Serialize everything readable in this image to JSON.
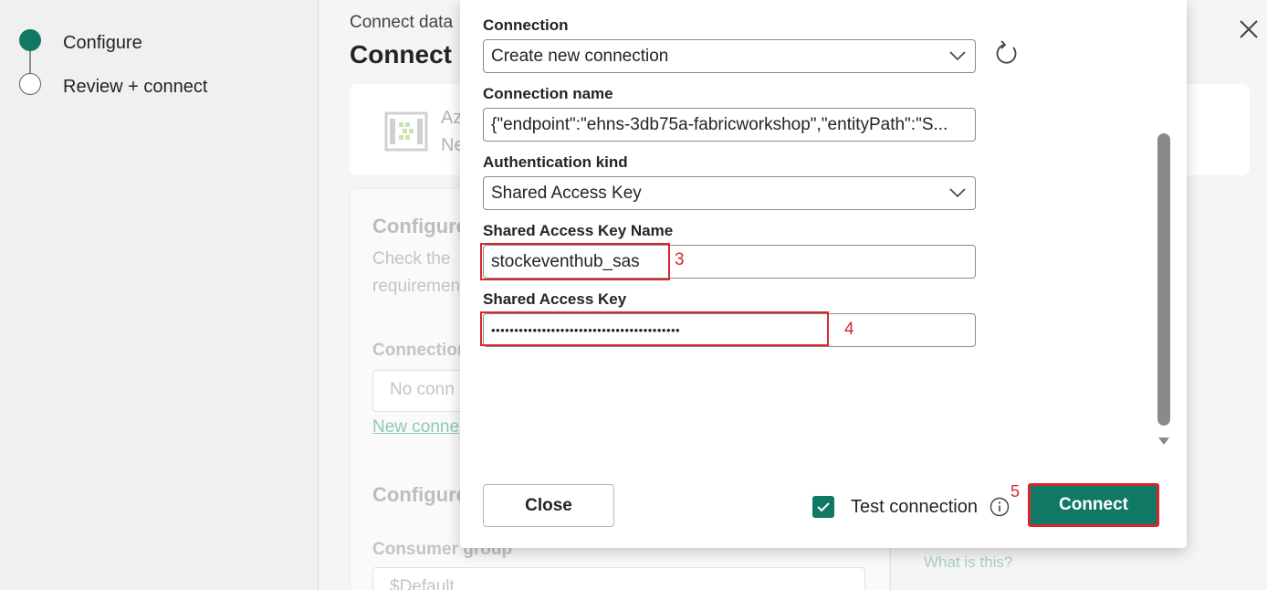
{
  "stepper": {
    "steps": [
      {
        "label": "Configure",
        "state": "active"
      },
      {
        "label": "Review + connect",
        "state": "pending"
      }
    ]
  },
  "main": {
    "breadcrumb": "Connect data",
    "title": "Connect",
    "source_card": {
      "line1": "Az",
      "line2": "Ne"
    },
    "configure_heading": "Configure",
    "configure_text_1": "Check the",
    "configure_text_2": "requirement",
    "connection_label": "Connection",
    "connection_placeholder": "No conn",
    "new_connection_link": "New conne",
    "configure_heading_2": "Configure",
    "consumer_group_label": "Consumer group",
    "consumer_group_value": "$Default",
    "what_is_this": "What is this?"
  },
  "dialog": {
    "connection_label": "Connection",
    "connection_value": "Create new connection",
    "connection_name_label": "Connection name",
    "connection_name_value": "{\"endpoint\":\"ehns-3db75a-fabricworkshop\",\"entityPath\":\"S...",
    "auth_kind_label": "Authentication kind",
    "auth_kind_value": "Shared Access Key",
    "sak_name_label": "Shared Access Key Name",
    "sak_name_value": "stockeventhub_sas",
    "sak_label": "Shared Access Key",
    "sak_value": "•••••••••••••••••••••••••••••••••••••••••",
    "close_button": "Close",
    "test_connection_label": "Test connection",
    "test_connection_checked": true,
    "connect_button": "Connect"
  },
  "annotations": {
    "a3": "3",
    "a4": "4",
    "a5": "5"
  },
  "colors": {
    "accent": "#117865",
    "annotation": "#d7262e"
  }
}
